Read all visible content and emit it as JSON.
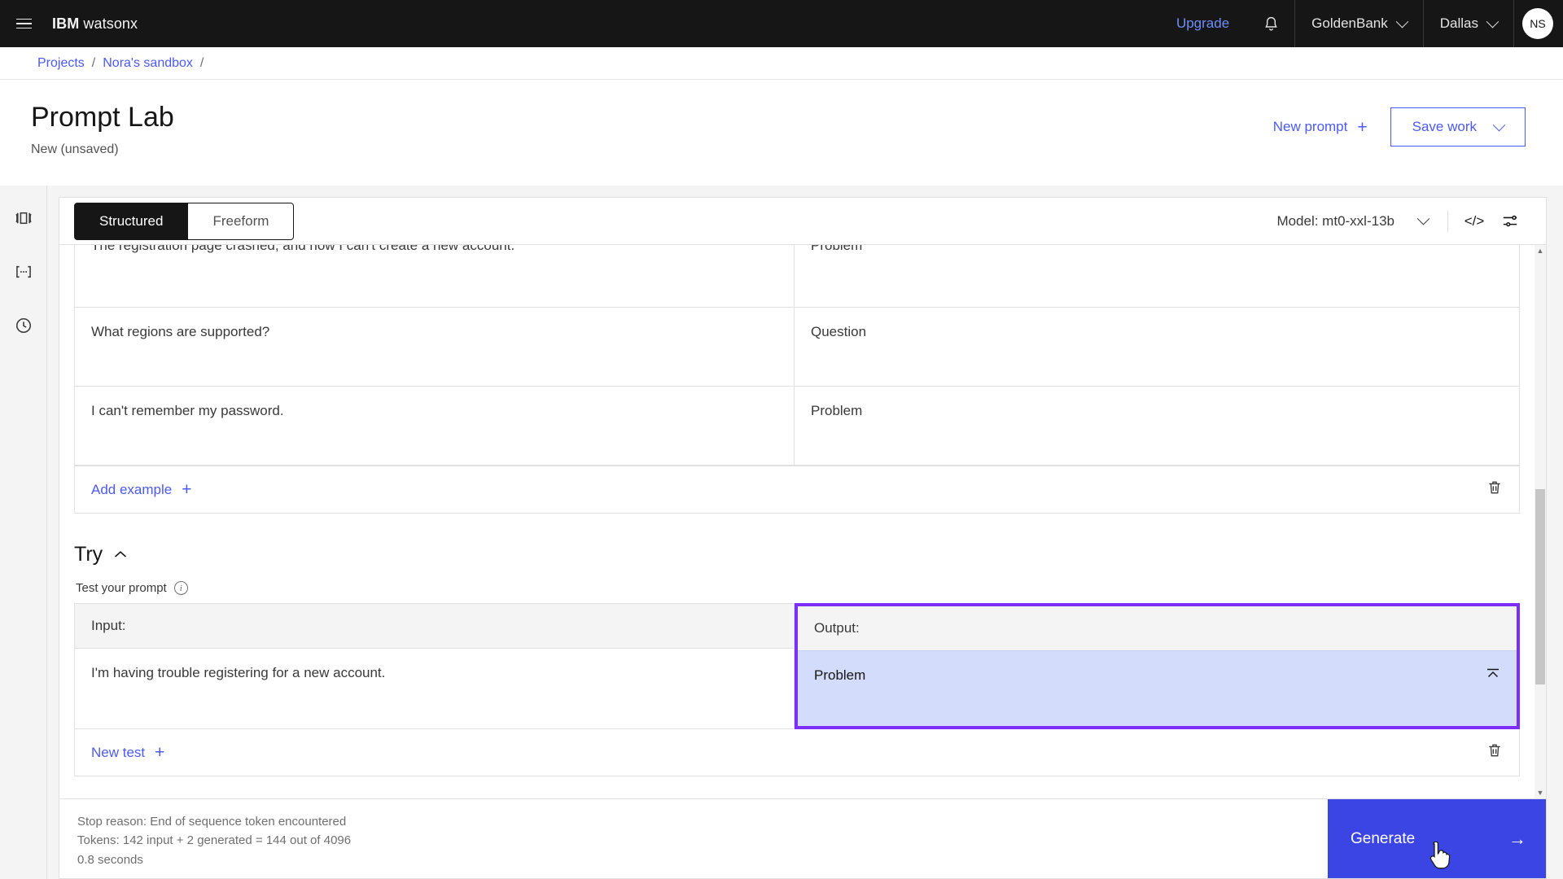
{
  "header": {
    "menu_icon": "hamburger-menu-icon",
    "brand_ibm": "IBM",
    "brand_product": "watsonx",
    "upgrade_label": "Upgrade",
    "notification_icon": "bell-icon",
    "account": "GoldenBank",
    "region": "Dallas",
    "avatar_initials": "NS"
  },
  "breadcrumb": {
    "items": [
      {
        "label": "Projects"
      },
      {
        "label": "Nora's sandbox"
      }
    ],
    "separator": "/",
    "trailing_separator": "/"
  },
  "page": {
    "title": "Prompt Lab",
    "subtitle": "New (unsaved)",
    "new_prompt_label": "New prompt",
    "new_prompt_icon": "plus-icon",
    "save_work_label": "Save work",
    "save_work_icon": "chevron-down-icon"
  },
  "rail": {
    "items": [
      {
        "icon": "session-panel-icon"
      },
      {
        "icon": "prompt-variables-icon"
      },
      {
        "icon": "history-clock-icon"
      }
    ]
  },
  "toolbar": {
    "tabs": [
      {
        "label": "Structured",
        "active": true
      },
      {
        "label": "Freeform",
        "active": false
      }
    ],
    "model_label": "Model: mt0-xxl-13b",
    "model_chevron_icon": "chevron-down-icon",
    "code_icon": "code-view-icon",
    "code_glyph": "</>",
    "settings_icon": "model-parameters-icon"
  },
  "examples": {
    "rows": [
      {
        "input": "The registration page crashed, and now I can't create a new account.",
        "output": "Problem",
        "clipped": true
      },
      {
        "input": "What regions are supported?",
        "output": "Question",
        "clipped": false
      },
      {
        "input": "I can't remember my password.",
        "output": "Problem",
        "clipped": false
      }
    ],
    "add_label": "Add example",
    "add_icon": "plus-icon",
    "delete_icon": "trash-icon"
  },
  "try": {
    "section_title": "Try",
    "collapse_icon": "chevron-up-icon",
    "test_label": "Test your prompt",
    "info_icon": "info-icon",
    "input_header": "Input:",
    "output_header": "Output:",
    "input_value": "I'm having trouble registering for a new account.",
    "output_value": "Problem",
    "output_collapse_icon": "collapse-up-icon",
    "new_test_label": "New test",
    "new_test_icon": "plus-icon",
    "delete_icon": "trash-icon",
    "highlight_color": "#7b2ff7",
    "output_bg_color": "#d3ddfb"
  },
  "footer": {
    "stop_reason": "Stop reason: End of sequence token encountered",
    "tokens": "Tokens: 142 input + 2 generated = 144 out of 4096",
    "duration": "0.8 seconds",
    "generate_label": "Generate",
    "generate_icon": "arrow-right-icon",
    "generate_color": "#3b45e3"
  }
}
